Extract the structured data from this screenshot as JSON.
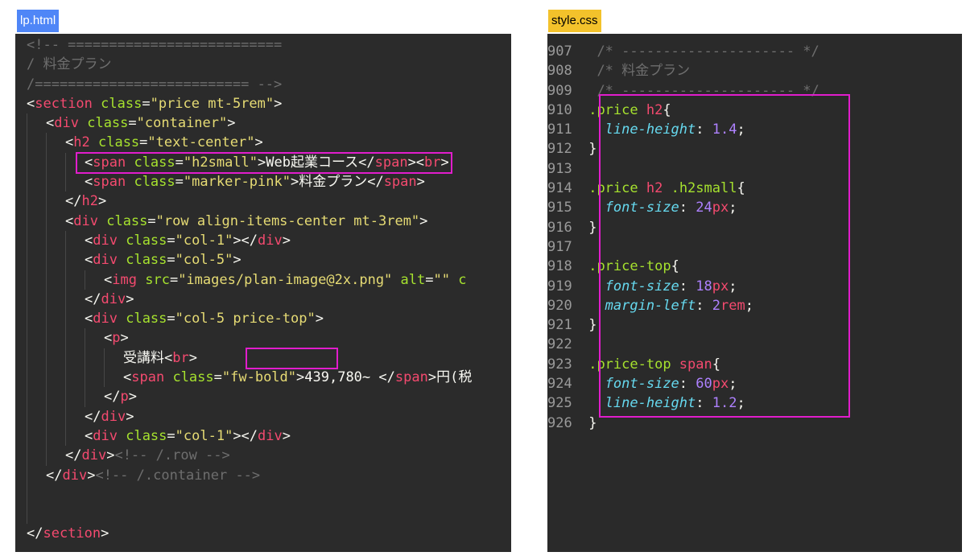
{
  "tabs": {
    "html": "lp.html",
    "css": "style.css"
  },
  "html_code": {
    "l1": "<!-- ==========================",
    "l2": "/ 料金プラン",
    "l3": "/========================== -->",
    "l4_tag": "section",
    "l4_attr": "class",
    "l4_val": "\"price mt-5rem\"",
    "l5_tag": "div",
    "l5_attr": "class",
    "l5_val": "\"container\"",
    "l6_tag": "h2",
    "l6_attr": "class",
    "l6_val": "\"text-center\"",
    "l7_tag": "span",
    "l7_attr": "class",
    "l7_val": "\"h2small\"",
    "l7_text": "Web起業コース",
    "l7_close": "span",
    "l7_br": "br",
    "l8_tag": "span",
    "l8_attr": "class",
    "l8_val": "\"marker-pink\"",
    "l8_text": "料金プラン",
    "l8_close": "span",
    "l9_close": "h2",
    "l10_tag": "div",
    "l10_attr": "class",
    "l10_val": "\"row align-items-center mt-3rem\"",
    "l11_tag": "div",
    "l11_attr": "class",
    "l11_val": "\"col-1\"",
    "l11_close": "div",
    "l12_tag": "div",
    "l12_attr": "class",
    "l12_val": "\"col-5\"",
    "l13_tag": "img",
    "l13_attr1": "src",
    "l13_val1": "\"images/plan-image@2x.png\"",
    "l13_attr2": "alt",
    "l13_val2": "\"\"",
    "l13_more": "c",
    "l14_close": "div",
    "l15_tag": "div",
    "l15_attr": "class",
    "l15_val_a": "\"col-5",
    "l15_val_b": " price-top",
    "l15_val_c": "\"",
    "l16_tag": "p",
    "l17_text": "受講料",
    "l17_br": "br",
    "l18_tag": "span",
    "l18_attr": "class",
    "l18_val": "\"fw-bold\"",
    "l18_text": "439,780~ ",
    "l18_close": "span",
    "l18_after": "円(税",
    "l19_close": "p",
    "l20_close": "div",
    "l21_tag": "div",
    "l21_attr": "class",
    "l21_val": "\"col-1\"",
    "l21_close": "div",
    "l22_close": "div",
    "l22_comment": "<!-- /.row -->",
    "l23_close": "div",
    "l23_comment": "<!-- /.container -->",
    "l26_close": "section"
  },
  "css_code": {
    "lines": [
      "907",
      "908",
      "909",
      "910",
      "911",
      "912",
      "913",
      "914",
      "915",
      "916",
      "917",
      "918",
      "919",
      "920",
      "921",
      "922",
      "923",
      "924",
      "925",
      "926"
    ],
    "c907": "/* --------------------- */",
    "c908": "/* 料金プラン",
    "c909": "/* --------------------- */",
    "s910": ".price ",
    "s910t": "h2",
    "b910": "{",
    "p911": "line-height",
    "v911": "1.4",
    "b912": "}",
    "s914": ".price ",
    "s914t": "h2",
    "s914c": " .h2small",
    "b914": "{",
    "p915": "font-size",
    "v915": "24",
    "u915": "px",
    "b916": "}",
    "s918": ".price-top",
    "b918": "{",
    "p919": "font-size",
    "v919": "18",
    "u919": "px",
    "p920": "margin-left",
    "v920": "2",
    "u920": "rem",
    "b921": "}",
    "s923": ".price-top ",
    "s923t": "span",
    "b923": "{",
    "p924": "font-size",
    "v924": "60",
    "u924": "px",
    "p925": "line-height",
    "v925": "1.2",
    "b926": "}"
  },
  "colors": {
    "highlight": "#e11dcc",
    "tag": "#f44a6f",
    "attr": "#a6e22e",
    "string": "#e6db74",
    "comment": "#6e6e6e"
  }
}
